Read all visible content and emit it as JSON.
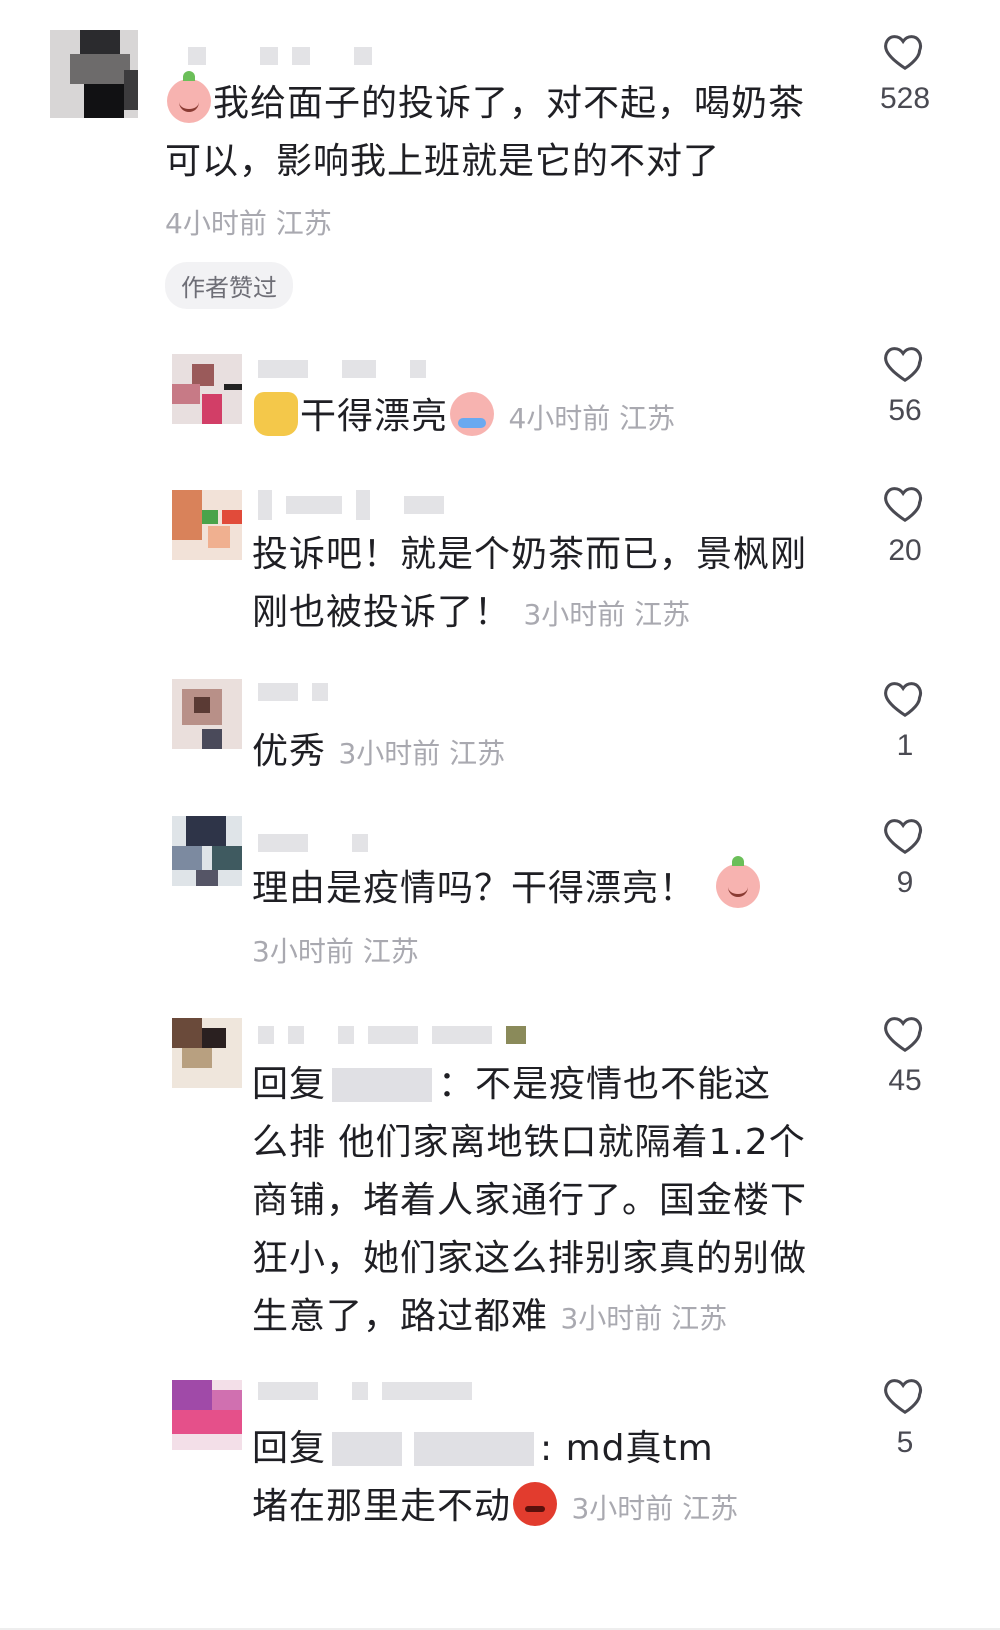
{
  "comments": [
    {
      "text_before": "",
      "text": "我给面子的投诉了，对不起，喝奶茶可以，影响我上班就是它的不对了",
      "line1": "我给面子的投诉了，对不起，喝奶茶",
      "line2": "可以，影响我上班就是它的不对了",
      "meta": "4小时前 江苏",
      "author_badge": "作者赞过",
      "likes": "528",
      "emoji": "baby-face-emoji"
    },
    {
      "text": "干得漂亮",
      "meta": "4小时前 江苏",
      "likes": "56",
      "emoji_before": "thumbs-up-emoji",
      "emoji_after": "crying-face-emoji"
    },
    {
      "line1": "投诉吧！就是个奶茶而已，景枫刚",
      "line2": "刚也被投诉了！",
      "meta": "3小时前 江苏",
      "likes": "20"
    },
    {
      "text": "优秀",
      "meta": "3小时前 江苏",
      "likes": "1"
    },
    {
      "text": "理由是疫情吗？干得漂亮！",
      "meta": "3小时前 江苏",
      "likes": "9",
      "emoji_after": "surprised-face-emoji"
    },
    {
      "reply_prefix": "回复",
      "line1_rest": "：不是疫情也不能这",
      "line2": "么排 他们家离地铁口就隔着1.2个",
      "line3": "商铺，堵着人家通行了。国金楼下",
      "line4": "狂小，她们家这么排别家真的别做",
      "line5": "生意了，路过都难",
      "meta": "3小时前 江苏",
      "likes": "45"
    },
    {
      "reply_prefix": "回复",
      "line1_rest": ": md真tm",
      "line2": "堵在那里走不动",
      "meta": "3小时前 江苏",
      "likes": "5",
      "emoji_after": "angry-face-emoji"
    }
  ],
  "colors": {
    "text": "#1f1f24",
    "meta": "#a9a9b0",
    "badge_bg": "#f2f2f4"
  },
  "icons": {
    "like": "heart-outline-icon"
  }
}
